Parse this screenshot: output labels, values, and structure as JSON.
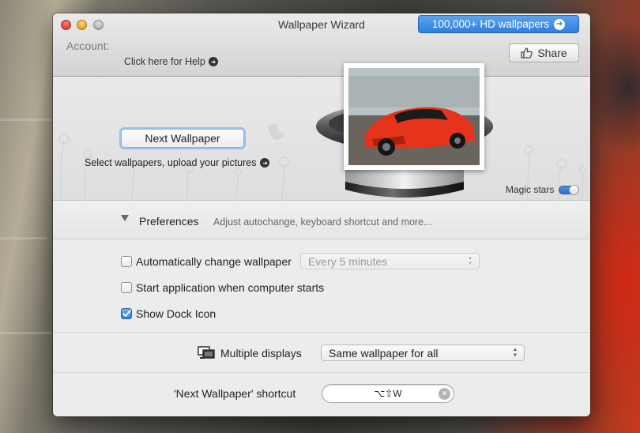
{
  "window": {
    "title": "Wallpaper Wizard",
    "promo_label": "100,000+ HD wallpapers"
  },
  "header": {
    "account_label": "Account:",
    "help_link": "Click here for Help",
    "share_label": "Share"
  },
  "hero": {
    "next_button": "Next Wallpaper",
    "select_link": "Select wallpapers, upload your pictures",
    "magic_stars_label": "Magic stars",
    "magic_stars_on": true
  },
  "preferences": {
    "title": "Preferences",
    "subtitle": "Adjust autochange, keyboard shortcut and more...",
    "options": [
      {
        "label": "Automatically change wallpaper",
        "checked": false
      },
      {
        "label": "Start application when computer starts",
        "checked": false
      },
      {
        "label": "Show Dock Icon",
        "checked": true
      }
    ],
    "autochange_interval": "Every 5 minutes"
  },
  "displays": {
    "label": "Multiple displays",
    "value": "Same wallpaper for all"
  },
  "shortcut": {
    "label": "'Next Wallpaper' shortcut",
    "value": "⌥⇧W"
  },
  "colors": {
    "accent_blue": "#2f7fdc",
    "car_red": "#e0341c",
    "window_bg": "#ececec"
  }
}
